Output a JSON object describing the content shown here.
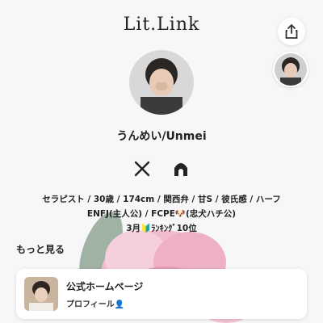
{
  "header": {
    "logo": "Lit.Link"
  },
  "profile": {
    "name": "うんめい/Unmei",
    "bio_lines": [
      "セラピスト / 30歳 / 174cm / 関西弁 / 甘S / 彼氏感 / ハーフ",
      "ENFJ(主人公) / FCPE🐶(忠犬ハチ公)",
      "3月🔰ﾗﾝｷﾝｸﾞ10位"
    ]
  },
  "social": {
    "x_icon": "x-logo-icon",
    "second_icon": "linktree-like-icon"
  },
  "section": {
    "more_label": "もっと見る"
  },
  "link_card": {
    "title": "公式ホームページ",
    "subtitle": "プロフィール👤"
  }
}
